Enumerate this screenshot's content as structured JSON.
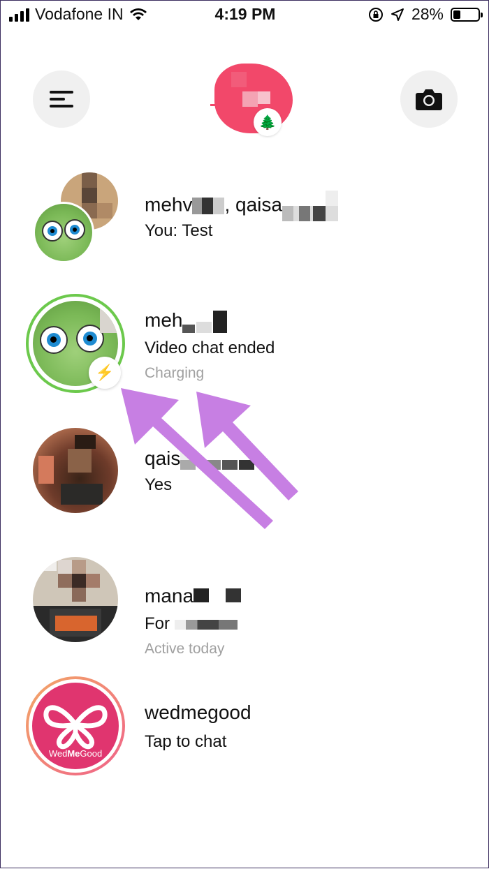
{
  "status_bar": {
    "carrier": "Vodafone IN",
    "time": "4:19 PM",
    "battery_percent": "28%",
    "battery_level": 0.28,
    "icons": [
      "signal-bars-icon",
      "wifi-icon",
      "rotation-lock-icon",
      "location-arrow-icon",
      "battery-icon"
    ]
  },
  "header": {
    "menu_icon": "hamburger-menu-icon",
    "camera_icon": "camera-icon",
    "profile_badge": "🌲"
  },
  "chats": [
    {
      "name": "mehv",
      "name2": ", qaisa",
      "message": "You: Test",
      "subtext": ""
    },
    {
      "name": "meh",
      "message": "Video chat ended",
      "subtext": "Charging",
      "badge": "⚡"
    },
    {
      "name": "qais",
      "message": "Yes",
      "subtext": ""
    },
    {
      "name": "mana",
      "message": "For ",
      "subtext": "Active today"
    },
    {
      "name": "wedmegood",
      "message": "Tap to chat",
      "subtext": "",
      "logo_text_a": "Wed",
      "logo_text_b": "Me",
      "logo_text_c": "Good"
    }
  ],
  "colors": {
    "accent_pink": "#f2486a",
    "active_ring": "#6cc94c",
    "annotation_arrow": "#c77fe3"
  }
}
